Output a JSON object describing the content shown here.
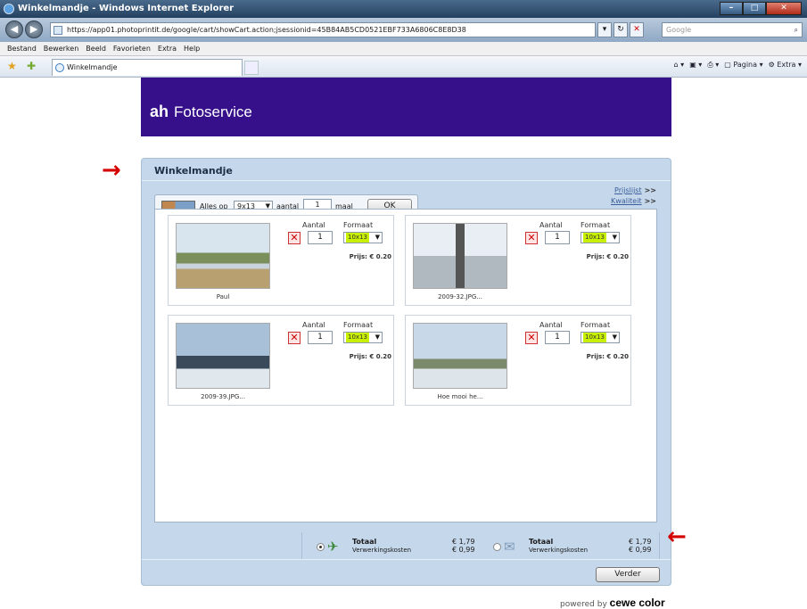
{
  "browser": {
    "window_title": "Winkelmandje - Windows Internet Explorer",
    "url": "https://app01.photoprintit.de/google/cart/showCart.action;jsessionid=45B84AB5CD0521EBF733A6806C8E8D38",
    "search_placeholder": "Google",
    "menu": [
      "Bestand",
      "Bewerken",
      "Beeld",
      "Favorieten",
      "Extra",
      "Help"
    ],
    "tab_title": "Winkelmandje",
    "cmd_pagina": "Pagina",
    "cmd_extra": "Extra"
  },
  "banner": {
    "logo_mark": "ah",
    "title": "Fotoservice"
  },
  "cart": {
    "title": "Winkelmandje",
    "links": {
      "prijslijst": "Prijslijst",
      "kwaliteit": "Kwaliteit",
      "more": ">>"
    },
    "bulk": {
      "label_prefix": "Alles op",
      "format": "9x13",
      "label_amount": "aantal",
      "quantity": "1",
      "label_times": "maal",
      "ok": "OK"
    },
    "col_amount": "Aantal",
    "col_format": "Formaat",
    "items": [
      {
        "caption": "Paul",
        "qty": "1",
        "format": "10x13",
        "price": "Prijs: € 0.20"
      },
      {
        "caption": "2009-32.JPG...",
        "qty": "1",
        "format": "10x13",
        "price": "Prijs: € 0.20"
      },
      {
        "caption": "2009-39.JPG...",
        "qty": "1",
        "format": "10x13",
        "price": "Prijs: € 0.20"
      },
      {
        "caption": "Hoe mooi he...",
        "qty": "1",
        "format": "10x13",
        "price": "Prijs: € 0.20"
      }
    ],
    "totals": [
      {
        "label": "Totaal",
        "sub": "Verwerkingskosten",
        "total": "€ 1,79",
        "fee": "€ 0,99"
      },
      {
        "label": "Totaal",
        "sub": "Verwerkingskosten",
        "total": "€ 1,79",
        "fee": "€ 0,99"
      }
    ],
    "next": "Verder"
  },
  "footer": {
    "powered_by": "powered by",
    "brand": "cewe color"
  },
  "colors": {
    "banner": "#35108a",
    "panel": "#c5d7ea",
    "arrow": "#d40000"
  }
}
